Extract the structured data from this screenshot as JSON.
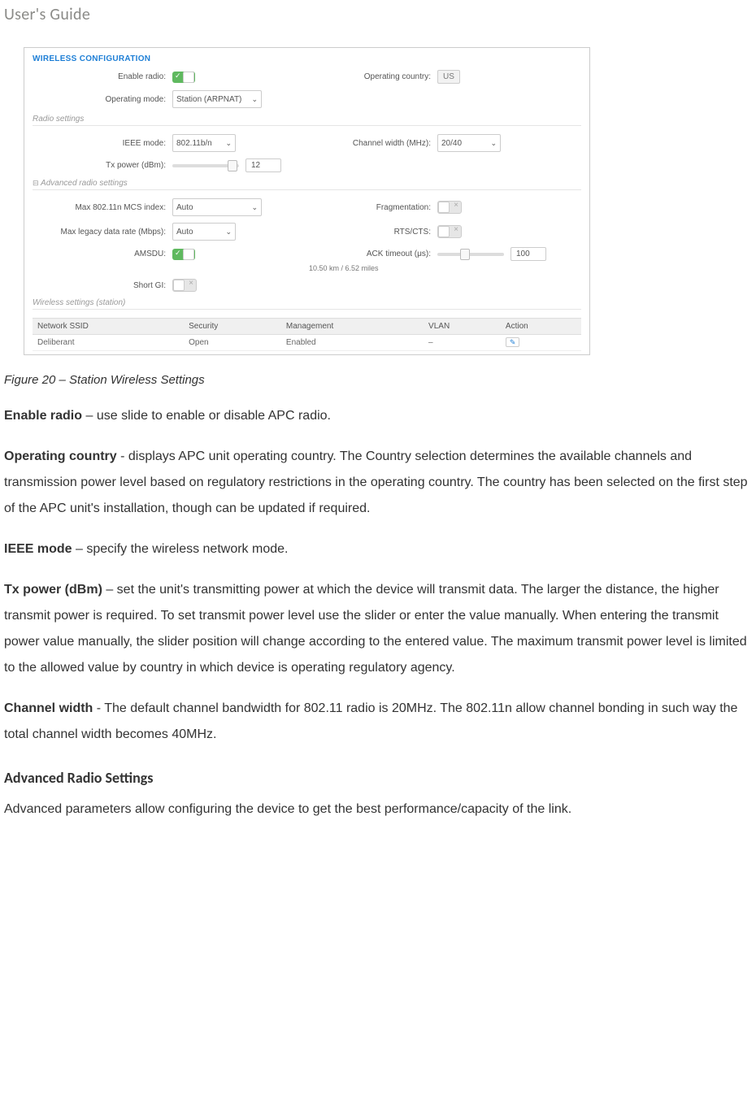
{
  "header": "User's Guide",
  "screenshot": {
    "title": "WIRELESS CONFIGURATION",
    "enable_radio_label": "Enable radio:",
    "operating_country_label": "Operating country:",
    "operating_country_value": "US",
    "operating_mode_label": "Operating mode:",
    "operating_mode_value": "Station (ARPNAT)",
    "radio_settings_section": "Radio settings",
    "ieee_mode_label": "IEEE mode:",
    "ieee_mode_value": "802.11b/n",
    "channel_width_label": "Channel width (MHz):",
    "channel_width_value": "20/40",
    "tx_power_label": "Tx power (dBm):",
    "tx_power_value": "12",
    "advanced_section": "Advanced radio settings",
    "max_mcs_label": "Max 802.11n MCS index:",
    "max_mcs_value": "Auto",
    "fragmentation_label": "Fragmentation:",
    "max_legacy_label": "Max legacy data rate (Mbps):",
    "max_legacy_value": "Auto",
    "rtscts_label": "RTS/CTS:",
    "amsdu_label": "AMSDU:",
    "ack_timeout_label": "ACK timeout (μs):",
    "ack_timeout_value": "100",
    "ack_note": "10.50 km / 6.52 miles",
    "short_gi_label": "Short GI:",
    "wireless_station_section": "Wireless settings (station)",
    "table": {
      "headers": [
        "Network SSID",
        "Security",
        "Management",
        "VLAN",
        "Action"
      ],
      "row": [
        "Deliberant",
        "Open",
        "Enabled",
        "–"
      ]
    }
  },
  "caption": "Figure 20 – Station Wireless Settings",
  "paragraphs": {
    "enable_radio": {
      "bold": "Enable radio",
      "text": " – use slide to enable or disable APC radio."
    },
    "operating_country": {
      "bold": "Operating country",
      "text": " - displays APC unit operating country. The Country selection determines the available channels and transmission power level based on regulatory restrictions in the operating country. The country has been selected on the first step of the APC unit's installation, though can be updated if required."
    },
    "ieee_mode": {
      "bold": "IEEE mode",
      "text": " – specify the wireless network mode."
    },
    "tx_power": {
      "bold": "Tx power (dBm)",
      "text": " – set the unit's transmitting power at which the device will transmit data. The larger the distance, the higher transmit power is required. To set transmit power level use the slider or enter the value manually. When entering the transmit power value manually, the slider position will change according to the entered value. The maximum transmit power level is limited to the allowed value by country in which device is operating regulatory agency."
    },
    "channel_width": {
      "bold": "Channel width",
      "text": " - The default channel bandwidth for 802.11 radio is 20MHz. The 802.11n allow channel bonding in such way the total channel width becomes 40MHz."
    }
  },
  "advanced_heading": "Advanced Radio Settings",
  "advanced_text": "Advanced parameters allow configuring the device to get the best performance/capacity of the link."
}
